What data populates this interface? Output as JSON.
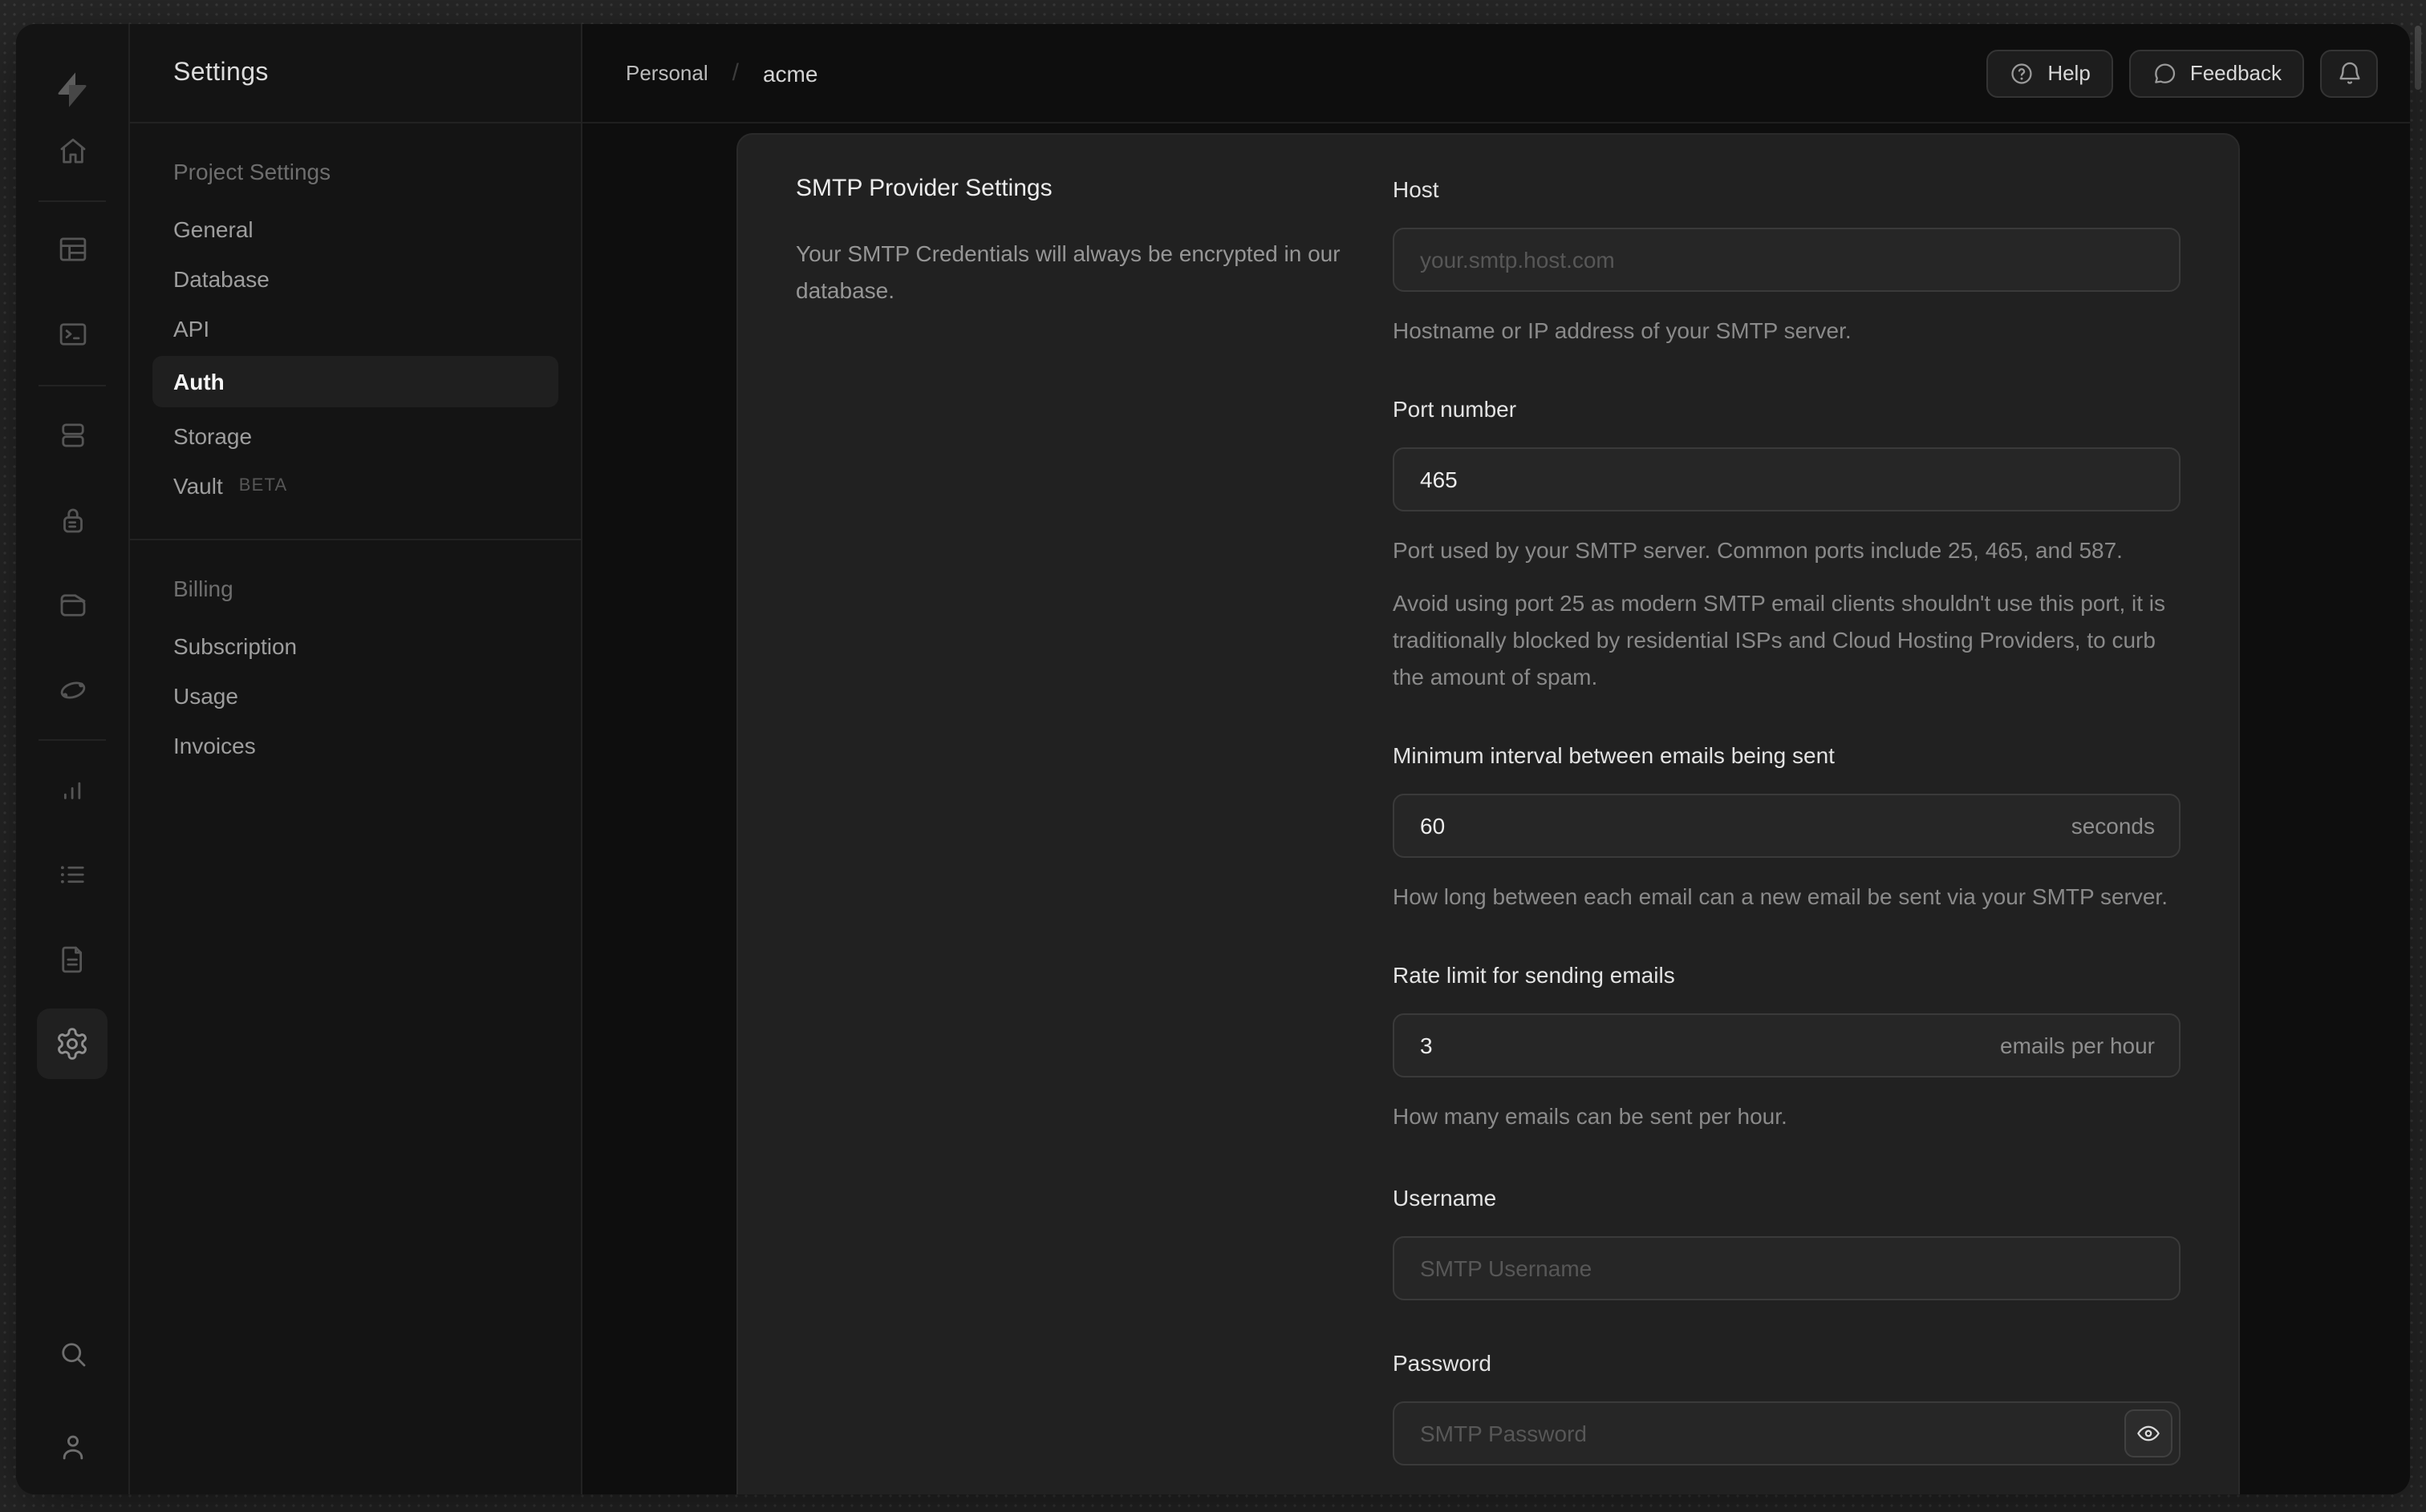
{
  "window_title": "Settings",
  "header": {
    "breadcrumb": {
      "org": "Personal",
      "separator": "/",
      "project": "acme"
    },
    "help_label": "Help",
    "feedback_label": "Feedback"
  },
  "sidebar": {
    "title": "Settings",
    "groups": [
      {
        "header": "Project Settings",
        "items": [
          {
            "label": "General"
          },
          {
            "label": "Database"
          },
          {
            "label": "API"
          },
          {
            "label": "Auth",
            "active": true
          },
          {
            "label": "Storage"
          },
          {
            "label": "Vault",
            "badge": "BETA"
          }
        ]
      },
      {
        "header": "Billing",
        "items": [
          {
            "label": "Subscription"
          },
          {
            "label": "Usage"
          },
          {
            "label": "Invoices"
          }
        ]
      }
    ]
  },
  "rail": {
    "icons": [
      "home",
      "table-editor",
      "sql-editor",
      "database",
      "authentication",
      "storage",
      "edge-functions",
      "reports",
      "logs",
      "docs",
      "project-settings"
    ],
    "bottom_icons": [
      "search",
      "account"
    ],
    "active": "project-settings"
  },
  "panel": {
    "heading": "SMTP Provider Settings",
    "description": "Your SMTP Credentials will always be encrypted in our database."
  },
  "form": {
    "host": {
      "label": "Host",
      "placeholder": "your.smtp.host.com",
      "helper": "Hostname or IP address of your SMTP server."
    },
    "port": {
      "label": "Port number",
      "value": "465",
      "helper": "Port used by your SMTP server. Common ports include 25, 465, and 587.",
      "note": "Avoid using port 25 as modern SMTP email clients shouldn't use this port, it is traditionally blocked by residential ISPs and Cloud Hosting Providers, to curb the amount of spam."
    },
    "interval": {
      "label": "Minimum interval between emails being sent",
      "value": "60",
      "suffix": "seconds",
      "helper": "How long between each email can a new email be sent via your SMTP server."
    },
    "rate": {
      "label": "Rate limit for sending emails",
      "value": "3",
      "suffix": "emails per hour",
      "helper": "How many emails can be sent per hour."
    },
    "username": {
      "label": "Username",
      "placeholder": "SMTP Username"
    },
    "password": {
      "label": "Password",
      "placeholder": "SMTP Password"
    }
  },
  "colors": {
    "backdrop": "#272727",
    "window_bg": "#0e0e0e",
    "sidebar_bg": "#141414",
    "panel_bg": "#212121",
    "input_bg": "#262626",
    "input_border": "#3a3a3a",
    "text_primary": "#ededed",
    "text_muted": "#8a8a8a",
    "active_pill": "#1f1f1f"
  }
}
